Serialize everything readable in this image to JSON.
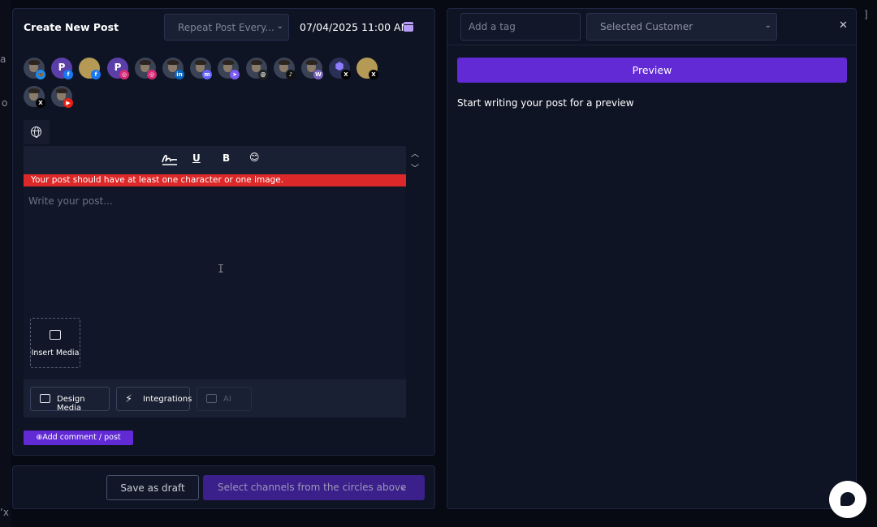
{
  "editor": {
    "title": "Create New Post",
    "repeat_placeholder": "Repeat Post Every...",
    "datetime": "07/04/2025 11:00 AM",
    "toolbar": {
      "underline": "U",
      "bold": "B",
      "emoji": "😊"
    },
    "error": "Your post should have at least one character or one image.",
    "text_placeholder": "Write your post...",
    "insert_media": "Insert Media",
    "media_buttons": {
      "design": "Design Media",
      "integrations": "Integrations",
      "ai": "AI"
    },
    "add_comment": "⊕Add comment / post"
  },
  "channels": [
    {
      "kind": "person",
      "badge": "bluesky",
      "badge_color": "#1d8cf0",
      "badge_glyph": "🦋"
    },
    {
      "kind": "letter",
      "badge": "facebook",
      "badge_color": "#1877f2",
      "badge_glyph": "f"
    },
    {
      "kind": "gold",
      "badge": "facebook",
      "badge_color": "#1877f2",
      "badge_glyph": "f"
    },
    {
      "kind": "letter",
      "badge": "instagram",
      "badge_color": "#d62976",
      "badge_glyph": "◎"
    },
    {
      "kind": "person",
      "badge": "instagram",
      "badge_color": "#d62976",
      "badge_glyph": "◎"
    },
    {
      "kind": "person",
      "badge": "linkedin",
      "badge_color": "#0a66c2",
      "badge_glyph": "in"
    },
    {
      "kind": "person",
      "badge": "mastodon",
      "badge_color": "#6364ff",
      "badge_glyph": "m"
    },
    {
      "kind": "person",
      "badge": "telegram",
      "badge_color": "#7b5cf5",
      "badge_glyph": "➤"
    },
    {
      "kind": "person",
      "badge": "threads",
      "badge_color": "#222222",
      "badge_glyph": "@"
    },
    {
      "kind": "person",
      "badge": "tiktok",
      "badge_color": "#111111",
      "badge_glyph": "♪"
    },
    {
      "kind": "person",
      "badge": "warpcast",
      "badge_color": "#7c65c1",
      "badge_glyph": "W"
    },
    {
      "kind": "cube",
      "badge": "x",
      "badge_color": "#000000",
      "badge_glyph": "X"
    },
    {
      "kind": "gold",
      "badge": "x",
      "badge_color": "#000000",
      "badge_glyph": "X"
    },
    {
      "kind": "person",
      "badge": "x",
      "badge_color": "#000000",
      "badge_glyph": "X"
    },
    {
      "kind": "person",
      "badge": "youtube",
      "badge_color": "#e62117",
      "badge_glyph": "▶"
    }
  ],
  "footer": {
    "save_draft": "Save as draft",
    "select_channels": "Select channels from the circles above"
  },
  "preview": {
    "tag_placeholder": "Add a tag",
    "customer": "Selected Customer",
    "button": "Preview",
    "text": "Start writing your post for a preview"
  },
  "icons": {
    "signature": "signature-icon",
    "globe": "globe-icon",
    "calendar": "calendar-icon",
    "chat": "chat-icon"
  },
  "colors": {
    "accent": "#612ad5",
    "error": "#dc2828",
    "background": "#0f1424"
  }
}
